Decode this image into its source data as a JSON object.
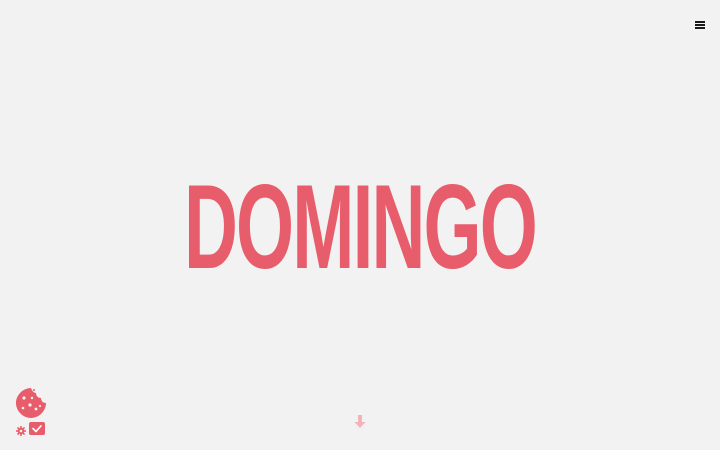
{
  "brand": {
    "logo_text": "DOMINGO",
    "color": "#e85d6b"
  },
  "header": {
    "menu_icon": "hamburger-menu-icon"
  },
  "cookie_widget": {
    "cookie_icon": "cookie-icon",
    "settings_icon": "gear-icon",
    "accept_icon": "checkmark-icon",
    "accent_color": "#e85d6b"
  },
  "scroll_hint": {
    "icon": "arrow-down-icon",
    "color": "#f3b3ba"
  },
  "colors": {
    "background": "#f3f2f2",
    "menu_icon": "#1a1a1a"
  }
}
